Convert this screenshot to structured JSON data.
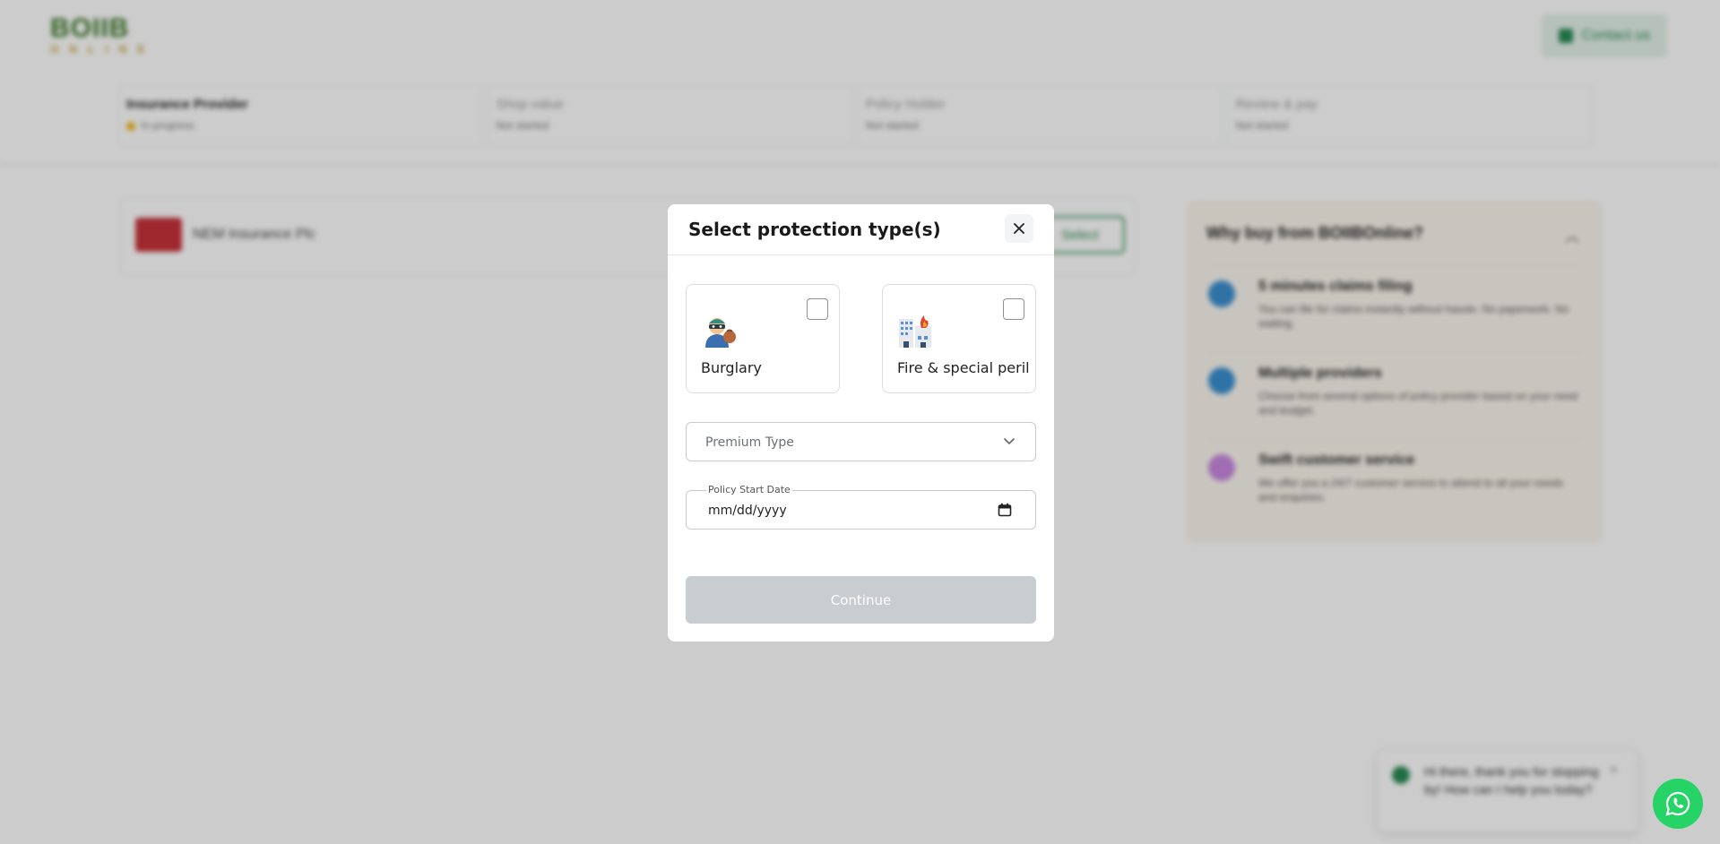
{
  "app": {
    "logo_top": "BOIIB",
    "logo_bottom": "ONLINE",
    "contact_label": "Contact us"
  },
  "stepper": {
    "steps": [
      {
        "title": "Insurance Provider",
        "status": "In progress"
      },
      {
        "title": "Shop value",
        "status": "Not started"
      },
      {
        "title": "Policy Holder",
        "status": "Not started"
      },
      {
        "title": "Review & pay",
        "status": "Not started"
      }
    ]
  },
  "provider": {
    "name": "NEM Insurance Plc",
    "select_label": "Select"
  },
  "why": {
    "title": "Why buy from BOIIBOnline?",
    "items": [
      {
        "title": "5 minutes claims filing",
        "desc": "You can file for claims instantly without hassle. No paperwork. No waiting."
      },
      {
        "title": "Multiple providers",
        "desc": "Choose from several options of policy provider based on your need and budget."
      },
      {
        "title": "Swift customer service",
        "desc": "We offer you a 24/7 customer service to attend to all your needs and enquiries."
      }
    ]
  },
  "chat": {
    "message": "Hi there, thank you for stopping by! How can I help you today?"
  },
  "modal": {
    "title": "Select protection type(s)",
    "options": [
      {
        "label": "Burglary",
        "icon": "burglar-icon",
        "checked": false
      },
      {
        "label": "Fire & special peril",
        "icon": "fire-building-icon",
        "checked": false
      }
    ],
    "premium_placeholder": "Premium Type",
    "date_label": "Policy Start Date",
    "date_value": "mm/dd/yyyy",
    "continue_label": "Continue"
  },
  "colors": {
    "brand_green": "#2a8a55",
    "whatsapp_green": "#25d366",
    "disabled_button": "#c8cdd2"
  }
}
